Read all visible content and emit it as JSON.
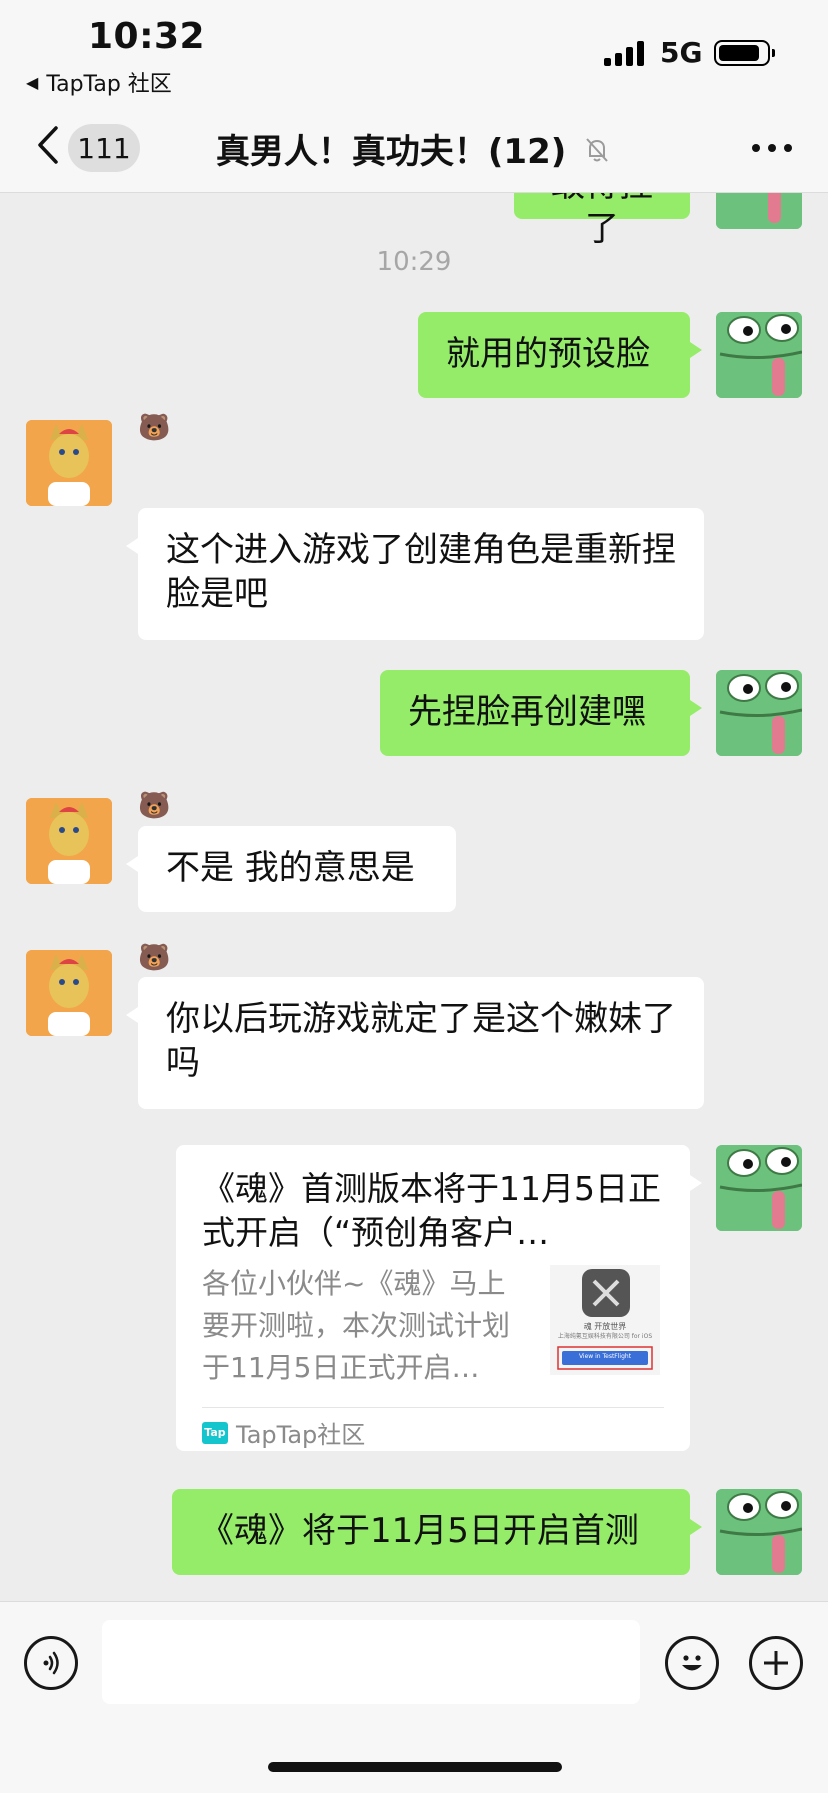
{
  "status_bar": {
    "time": "10:32",
    "back_app": "TapTap 社区",
    "network": "5G"
  },
  "nav": {
    "unread_count": "111",
    "title": "真男人！真功夫！(12)"
  },
  "messages": {
    "top_partial": "敢得捏了",
    "time_divider": "10:29",
    "m1": "就用的预设脸",
    "m2": "这个进入游戏了创建角色是重新捏脸是吧",
    "m3": "先捏脸再创建嘿",
    "m4": "不是 我的意思是",
    "m5": "你以后玩游戏就定了是这个嫩妹了吗",
    "m7": "《魂》将于11月5日开启首测",
    "sender_emoji": "🐻"
  },
  "link_card": {
    "title": "《魂》首测版本将于11月5日正式开启（“预创角客户…",
    "body": "各位小伙伴~《魂》马上要开测啦，本次测试计划于11月5日正式开启…",
    "source": "TapTap社区",
    "logo_text": "Tap",
    "thumb_line1": "魂 开放世界",
    "thumb_line2": "上海纯氪互娱科技有限公司 for iOS",
    "thumb_button": "View in TestFlight"
  },
  "input": {
    "placeholder": ""
  }
}
